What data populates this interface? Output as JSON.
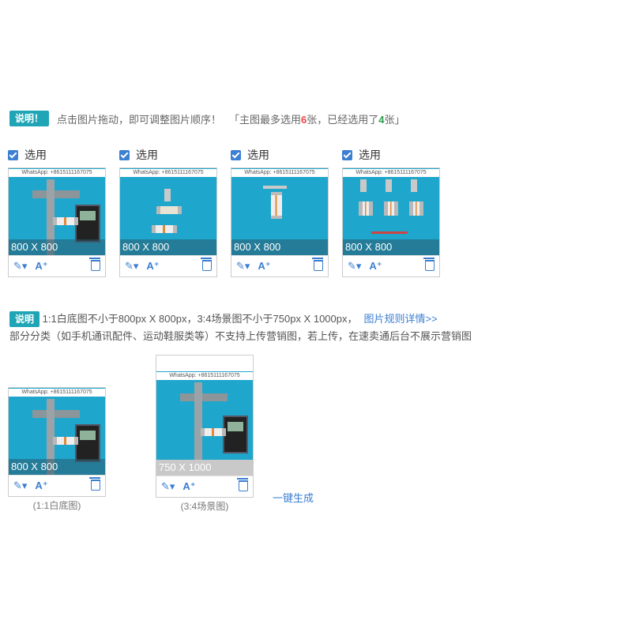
{
  "tip": {
    "badge": "说明！",
    "text": "点击图片拖动，即可调整图片顺序！",
    "count_prefix": "「主图最多选用",
    "max": "6",
    "count_mid": "张，已经选用了",
    "used": "4",
    "count_suffix": "张」"
  },
  "main_images": [
    {
      "select_label": "选用",
      "watermark": "WhatsApp: +8615111167075",
      "size": "800 X 800"
    },
    {
      "select_label": "选用",
      "watermark": "WhatsApp: +8615111167075",
      "size": "800 X 800"
    },
    {
      "select_label": "选用",
      "watermark": "WhatsApp: +8615111167075",
      "size": "800 X 800"
    },
    {
      "select_label": "选用",
      "watermark": "WhatsApp: +8615111167075",
      "size": "800 X 800"
    }
  ],
  "icons": {
    "wand": "magic-wand-icon",
    "ai": "ai-text-icon",
    "delete": "trash-icon"
  },
  "toolbar": {
    "wand_glyph": "✎▾",
    "ai_glyph": "A⁺"
  },
  "note": {
    "badge": "说明",
    "line1": "1:1白底图不小于800px X 800px，3:4场景图不小于750px X 1000px，",
    "link": "图片规则详情>>",
    "line2": "部分分类（如手机通讯配件、运动鞋服类等）不支持上传营销图，若上传，在速卖通后台不展示营销图"
  },
  "marketing_images": [
    {
      "watermark": "WhatsApp: +8615111167075",
      "size": "800 X 800",
      "caption": "(1:1白底图)"
    },
    {
      "watermark": "WhatsApp: +8615111167075",
      "size": "750 X 1000",
      "caption": "(3:4场景图)"
    }
  ],
  "generate_label": "一键生成",
  "colors": {
    "accent": "#1fa5b5",
    "link": "#3a7ed1",
    "red": "#e44444",
    "green": "#2a9d4b",
    "photo_bg": "#1fa6cc"
  }
}
